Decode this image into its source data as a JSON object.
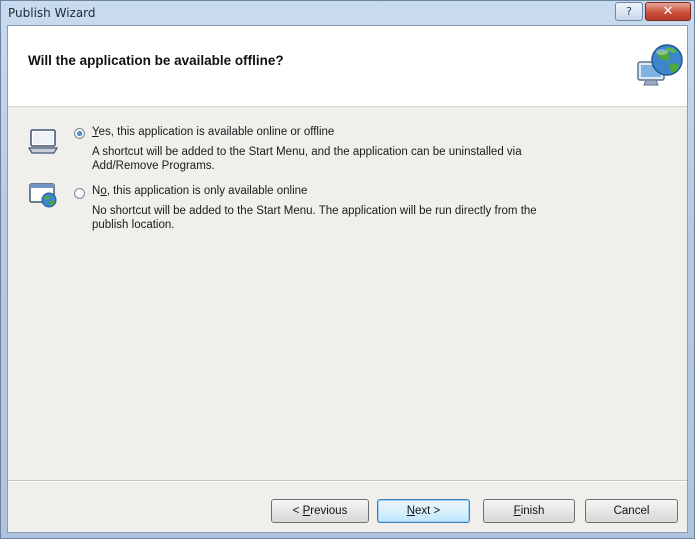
{
  "window": {
    "title": "Publish Wizard",
    "help_label": "?",
    "close_label": "✕"
  },
  "header": {
    "title": "Will the application be available offline?",
    "icon": "globe-network-icon"
  },
  "options": [
    {
      "mnemonic": "Y",
      "label_rest": "es, this application is available online or offline",
      "description": "A shortcut will be added to the Start Menu, and the application can be uninstalled via Add/Remove Programs.",
      "checked": true,
      "icon": "laptop-icon"
    },
    {
      "label_prefix": "N",
      "mnemonic": "o",
      "label_rest": ", this application is only available online",
      "description": "No shortcut will be added to the Start Menu. The application will be run directly from the publish location.",
      "checked": false,
      "icon": "web-window-icon"
    }
  ],
  "buttons": {
    "previous": {
      "prefix": "< ",
      "mnemonic": "P",
      "rest": "revious"
    },
    "next": {
      "mnemonic": "N",
      "rest": "ext >"
    },
    "finish": {
      "mnemonic": "F",
      "rest": "inish"
    },
    "cancel": "Cancel"
  },
  "colors": {
    "accent": "#3c7fb1",
    "close": "#c9513c",
    "header_bg": "#ffffff",
    "body_bg": "#f0efec"
  }
}
